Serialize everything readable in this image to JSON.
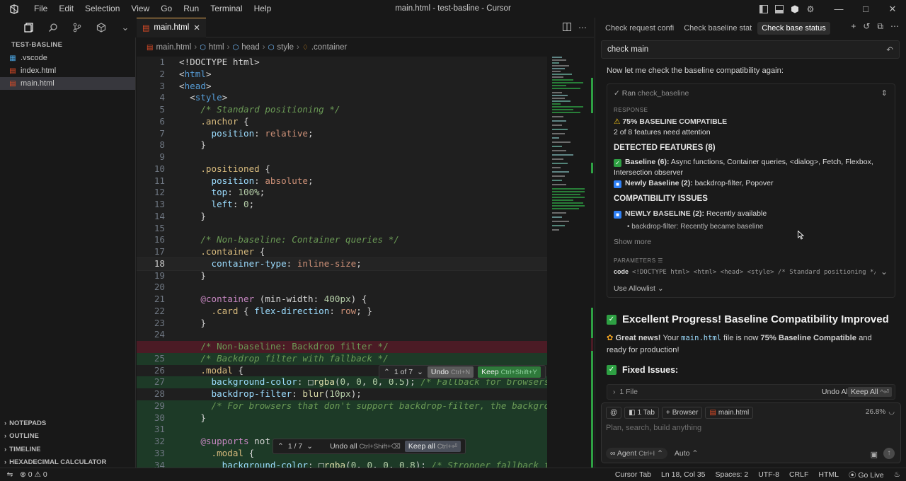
{
  "title": {
    "window_title": "main.html - test-basline - Cursor",
    "menu": [
      "File",
      "Edit",
      "Selection",
      "View",
      "Go",
      "Run",
      "Terminal",
      "Help"
    ]
  },
  "explorer": {
    "workspace": "TEST-BASLINE",
    "files": [
      {
        "name": ".vscode",
        "icon": "folder-icon"
      },
      {
        "name": "index.html",
        "icon": "html-icon"
      },
      {
        "name": "main.html",
        "icon": "html-icon",
        "selected": true
      }
    ],
    "panels": [
      "NOTEPADS",
      "OUTLINE",
      "TIMELINE",
      "HEXADECIMAL CALCULATOR"
    ]
  },
  "editor": {
    "tab_label": "main.html",
    "breadcrumb": [
      "main.html",
      "html",
      "head",
      "style",
      ".container"
    ],
    "current_line": 18,
    "lines": [
      {
        "n": "1",
        "html": "<span class='t-w'>&lt;!DOCTYPE html&gt;</span>"
      },
      {
        "n": "2",
        "html": "<span class='t-w'>&lt;</span><span class='t-tag'>html</span><span class='t-w'>&gt;</span>"
      },
      {
        "n": "3",
        "html": "<span class='t-w'>&lt;</span><span class='t-tag'>head</span><span class='t-w'>&gt;</span>"
      },
      {
        "n": "4",
        "html": "  <span class='t-w'>&lt;</span><span class='t-tag'>style</span><span class='t-w'>&gt;</span>"
      },
      {
        "n": "5",
        "html": "    <span class='t-c'>/* Standard positioning */</span>"
      },
      {
        "n": "6",
        "html": "    <span class='t-s'>.anchor</span><span class='t-w'> {</span>"
      },
      {
        "n": "7",
        "html": "      <span class='t-p'>position</span><span class='t-w'>: </span><span class='t-v'>relative</span><span class='t-w'>;</span>"
      },
      {
        "n": "8",
        "html": "    <span class='t-w'>}</span>"
      },
      {
        "n": "9",
        "html": ""
      },
      {
        "n": "10",
        "html": "    <span class='t-s'>.positioned</span><span class='t-w'> {</span>"
      },
      {
        "n": "11",
        "html": "      <span class='t-p'>position</span><span class='t-w'>: </span><span class='t-v'>absolute</span><span class='t-w'>;</span>"
      },
      {
        "n": "12",
        "html": "      <span class='t-p'>top</span><span class='t-w'>: </span><span class='t-n'>100%</span><span class='t-w'>;</span>"
      },
      {
        "n": "13",
        "html": "      <span class='t-p'>left</span><span class='t-w'>: </span><span class='t-n'>0</span><span class='t-w'>;</span>"
      },
      {
        "n": "14",
        "html": "    <span class='t-w'>}</span>"
      },
      {
        "n": "15",
        "html": ""
      },
      {
        "n": "16",
        "html": "    <span class='t-c'>/* Non-baseline: Container queries */</span>"
      },
      {
        "n": "17",
        "html": "    <span class='t-s'>.container</span><span class='t-w'> {</span>"
      },
      {
        "n": "18",
        "html": "      <span class='t-p'>container-type</span><span class='t-w'>: </span><span class='t-v'>inline-size</span><span class='t-w'>;</span>",
        "cur": true
      },
      {
        "n": "19",
        "html": "    <span class='t-w'>}</span>"
      },
      {
        "n": "20",
        "html": ""
      },
      {
        "n": "21",
        "html": "    <span class='t-at'>@container</span><span class='t-w'> (min-width: </span><span class='t-n'>400px</span><span class='t-w'>) {</span>"
      },
      {
        "n": "22",
        "html": "      <span class='t-s'>.card</span><span class='t-w'> { </span><span class='t-p'>flex-direction</span><span class='t-w'>: </span><span class='t-v'>row</span><span class='t-w'>; }</span>"
      },
      {
        "n": "23",
        "html": "    <span class='t-w'>}</span>"
      },
      {
        "n": "24",
        "html": ""
      },
      {
        "n": "",
        "html": "    <span class='t-c' style='font-style:normal'>/* Non-baseline: Backdrop filter */</span>",
        "del": true
      },
      {
        "n": "25",
        "html": "    <span class='t-c'>/* Backdrop filter with fallback */</span>",
        "add": true
      },
      {
        "n": "26",
        "html": "    <span class='t-s'>.modal</span><span class='t-w'> {</span>"
      },
      {
        "n": "27",
        "html": "      <span class='t-p'>background-color</span><span class='t-w'>: </span><span class='t-w'>&#9633;</span><span class='t-f'>rgba</span><span class='t-w'>(</span><span class='t-n'>0</span><span class='t-w'>, </span><span class='t-n'>0</span><span class='t-w'>, </span><span class='t-n'>0</span><span class='t-w'>, </span><span class='t-n'>0.5</span><span class='t-w'>); </span><span class='t-c'>/* Fallback for browsers</span>",
        "add": true
      },
      {
        "n": "28",
        "html": "      <span class='t-p'>backdrop-filter</span><span class='t-w'>: </span><span class='t-f'>blur</span><span class='t-w'>(</span><span class='t-n'>10px</span><span class='t-w'>);</span>"
      },
      {
        "n": "29",
        "html": "      <span class='t-c'>/* For browsers that don't support backdrop-filter, the backgro</span>",
        "add": true
      },
      {
        "n": "30",
        "html": "    <span class='t-w'>}</span>",
        "add": true
      },
      {
        "n": "31",
        "html": "",
        "add": true
      },
      {
        "n": "32",
        "html": "    <span class='t-at'>@supports</span><span class='t-w'> not</span>",
        "add": true
      },
      {
        "n": "33",
        "html": "      <span class='t-s'>.modal</span><span class='t-w'> {</span>",
        "add": true
      },
      {
        "n": "34",
        "html": "        <span class='t-p'>background-color</span><span class='t-w'>: </span><span class='t-w'>&#9633;</span><span class='t-f'>rgba</span><span class='t-w'>(</span><span class='t-n'>0</span><span class='t-w'>, </span><span class='t-n'>0</span><span class='t-w'>, </span><span class='t-n'>0</span><span class='t-w'>, </span><span class='t-n'>0.8</span><span class='t-w'>); </span><span class='t-c'>/* Stronger fallback f</span>",
        "add": true
      }
    ],
    "hunk_widget": {
      "count": "1 of 7",
      "undo": "Undo",
      "undo_kb": "Ctrl+N",
      "keep": "Keep",
      "keep_kb": "Ctrl+Shift+Y"
    },
    "file_widget": {
      "count": "1 / 7",
      "undo": "Undo all",
      "undo_kb": "Ctrl+Shift+⌫",
      "keep": "Keep all",
      "keep_kb": "Ctrl+⏎"
    }
  },
  "chat": {
    "tabs": [
      "Check request confi",
      "Check baseline stat",
      "Check base status"
    ],
    "query": "check main",
    "intro": "Now let me check the baseline compatibility again:",
    "tool": {
      "ran": "Ran",
      "name": "check_baseline",
      "response_label": "RESPONSE",
      "status": "75% BASELINE COMPATIBLE",
      "status_sub": "2 of 8 features need attention",
      "detected_heading": "DETECTED FEATURES (8)",
      "baseline_label": "Baseline (6):",
      "baseline_text": "Async functions, Container queries, <dialog>, Fetch, Flexbox, Intersection observer",
      "newly_label": "Newly Baseline (2):",
      "newly_text": "backdrop-filter, Popover",
      "issues_heading": "COMPATIBILITY ISSUES",
      "issue_label": "NEWLY BASELINE (2):",
      "issue_text": "Recently available",
      "issue_bullet": "backdrop-filter: Recently became baseline",
      "show_more": "Show more",
      "params_label": "PARAMETERS",
      "param_key": "code",
      "param_value": "<!DOCTYPE html> <html> <head> <style> /* Standard positioning */ .a…",
      "allowlist": "Use Allowlist"
    },
    "progress_heading": "Excellent Progress! Baseline Compatibility Improved",
    "great_bold": "Great news!",
    "great_text1": "Your",
    "great_file": "main.html",
    "great_text2": "file is now",
    "great_bold2": "75% Baseline Compatible",
    "great_text3": "and ready for production!",
    "fixed_heading": "Fixed Issues:",
    "files_label": "1 File",
    "undo_all": "Undo All",
    "keep_all": "Keep All",
    "keep_all_kb": "^⏎",
    "composer": {
      "at": "@",
      "tab_chip": "1 Tab",
      "browser_chip": "Browser",
      "file_chip": "main.html",
      "context_pct": "26.8%",
      "placeholder": "Plan, search, build anything",
      "mode": "Agent",
      "mode_kb": "Ctrl+I",
      "model": "Auto"
    }
  },
  "statusbar": {
    "errors": "0",
    "warnings": "0",
    "cursor_tab": "Cursor Tab",
    "position": "Ln 18, Col 35",
    "spaces": "Spaces: 2",
    "encoding": "UTF-8",
    "eol": "CRLF",
    "lang": "HTML",
    "golive": "Go Live"
  }
}
